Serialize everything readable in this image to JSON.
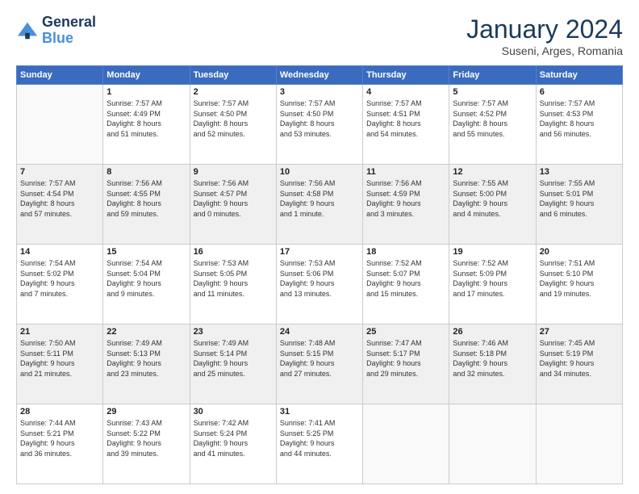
{
  "logo": {
    "line1": "General",
    "line2": "Blue"
  },
  "title": "January 2024",
  "location": "Suseni, Arges, Romania",
  "weekdays": [
    "Sunday",
    "Monday",
    "Tuesday",
    "Wednesday",
    "Thursday",
    "Friday",
    "Saturday"
  ],
  "weeks": [
    [
      {
        "day": "",
        "info": ""
      },
      {
        "day": "1",
        "info": "Sunrise: 7:57 AM\nSunset: 4:49 PM\nDaylight: 8 hours\nand 51 minutes."
      },
      {
        "day": "2",
        "info": "Sunrise: 7:57 AM\nSunset: 4:50 PM\nDaylight: 8 hours\nand 52 minutes."
      },
      {
        "day": "3",
        "info": "Sunrise: 7:57 AM\nSunset: 4:50 PM\nDaylight: 8 hours\nand 53 minutes."
      },
      {
        "day": "4",
        "info": "Sunrise: 7:57 AM\nSunset: 4:51 PM\nDaylight: 8 hours\nand 54 minutes."
      },
      {
        "day": "5",
        "info": "Sunrise: 7:57 AM\nSunset: 4:52 PM\nDaylight: 8 hours\nand 55 minutes."
      },
      {
        "day": "6",
        "info": "Sunrise: 7:57 AM\nSunset: 4:53 PM\nDaylight: 8 hours\nand 56 minutes."
      }
    ],
    [
      {
        "day": "7",
        "info": "Sunrise: 7:57 AM\nSunset: 4:54 PM\nDaylight: 8 hours\nand 57 minutes."
      },
      {
        "day": "8",
        "info": "Sunrise: 7:56 AM\nSunset: 4:55 PM\nDaylight: 8 hours\nand 59 minutes."
      },
      {
        "day": "9",
        "info": "Sunrise: 7:56 AM\nSunset: 4:57 PM\nDaylight: 9 hours\nand 0 minutes."
      },
      {
        "day": "10",
        "info": "Sunrise: 7:56 AM\nSunset: 4:58 PM\nDaylight: 9 hours\nand 1 minute."
      },
      {
        "day": "11",
        "info": "Sunrise: 7:56 AM\nSunset: 4:59 PM\nDaylight: 9 hours\nand 3 minutes."
      },
      {
        "day": "12",
        "info": "Sunrise: 7:55 AM\nSunset: 5:00 PM\nDaylight: 9 hours\nand 4 minutes."
      },
      {
        "day": "13",
        "info": "Sunrise: 7:55 AM\nSunset: 5:01 PM\nDaylight: 9 hours\nand 6 minutes."
      }
    ],
    [
      {
        "day": "14",
        "info": "Sunrise: 7:54 AM\nSunset: 5:02 PM\nDaylight: 9 hours\nand 7 minutes."
      },
      {
        "day": "15",
        "info": "Sunrise: 7:54 AM\nSunset: 5:04 PM\nDaylight: 9 hours\nand 9 minutes."
      },
      {
        "day": "16",
        "info": "Sunrise: 7:53 AM\nSunset: 5:05 PM\nDaylight: 9 hours\nand 11 minutes."
      },
      {
        "day": "17",
        "info": "Sunrise: 7:53 AM\nSunset: 5:06 PM\nDaylight: 9 hours\nand 13 minutes."
      },
      {
        "day": "18",
        "info": "Sunrise: 7:52 AM\nSunset: 5:07 PM\nDaylight: 9 hours\nand 15 minutes."
      },
      {
        "day": "19",
        "info": "Sunrise: 7:52 AM\nSunset: 5:09 PM\nDaylight: 9 hours\nand 17 minutes."
      },
      {
        "day": "20",
        "info": "Sunrise: 7:51 AM\nSunset: 5:10 PM\nDaylight: 9 hours\nand 19 minutes."
      }
    ],
    [
      {
        "day": "21",
        "info": "Sunrise: 7:50 AM\nSunset: 5:11 PM\nDaylight: 9 hours\nand 21 minutes."
      },
      {
        "day": "22",
        "info": "Sunrise: 7:49 AM\nSunset: 5:13 PM\nDaylight: 9 hours\nand 23 minutes."
      },
      {
        "day": "23",
        "info": "Sunrise: 7:49 AM\nSunset: 5:14 PM\nDaylight: 9 hours\nand 25 minutes."
      },
      {
        "day": "24",
        "info": "Sunrise: 7:48 AM\nSunset: 5:15 PM\nDaylight: 9 hours\nand 27 minutes."
      },
      {
        "day": "25",
        "info": "Sunrise: 7:47 AM\nSunset: 5:17 PM\nDaylight: 9 hours\nand 29 minutes."
      },
      {
        "day": "26",
        "info": "Sunrise: 7:46 AM\nSunset: 5:18 PM\nDaylight: 9 hours\nand 32 minutes."
      },
      {
        "day": "27",
        "info": "Sunrise: 7:45 AM\nSunset: 5:19 PM\nDaylight: 9 hours\nand 34 minutes."
      }
    ],
    [
      {
        "day": "28",
        "info": "Sunrise: 7:44 AM\nSunset: 5:21 PM\nDaylight: 9 hours\nand 36 minutes."
      },
      {
        "day": "29",
        "info": "Sunrise: 7:43 AM\nSunset: 5:22 PM\nDaylight: 9 hours\nand 39 minutes."
      },
      {
        "day": "30",
        "info": "Sunrise: 7:42 AM\nSunset: 5:24 PM\nDaylight: 9 hours\nand 41 minutes."
      },
      {
        "day": "31",
        "info": "Sunrise: 7:41 AM\nSunset: 5:25 PM\nDaylight: 9 hours\nand 44 minutes."
      },
      {
        "day": "",
        "info": ""
      },
      {
        "day": "",
        "info": ""
      },
      {
        "day": "",
        "info": ""
      }
    ]
  ]
}
